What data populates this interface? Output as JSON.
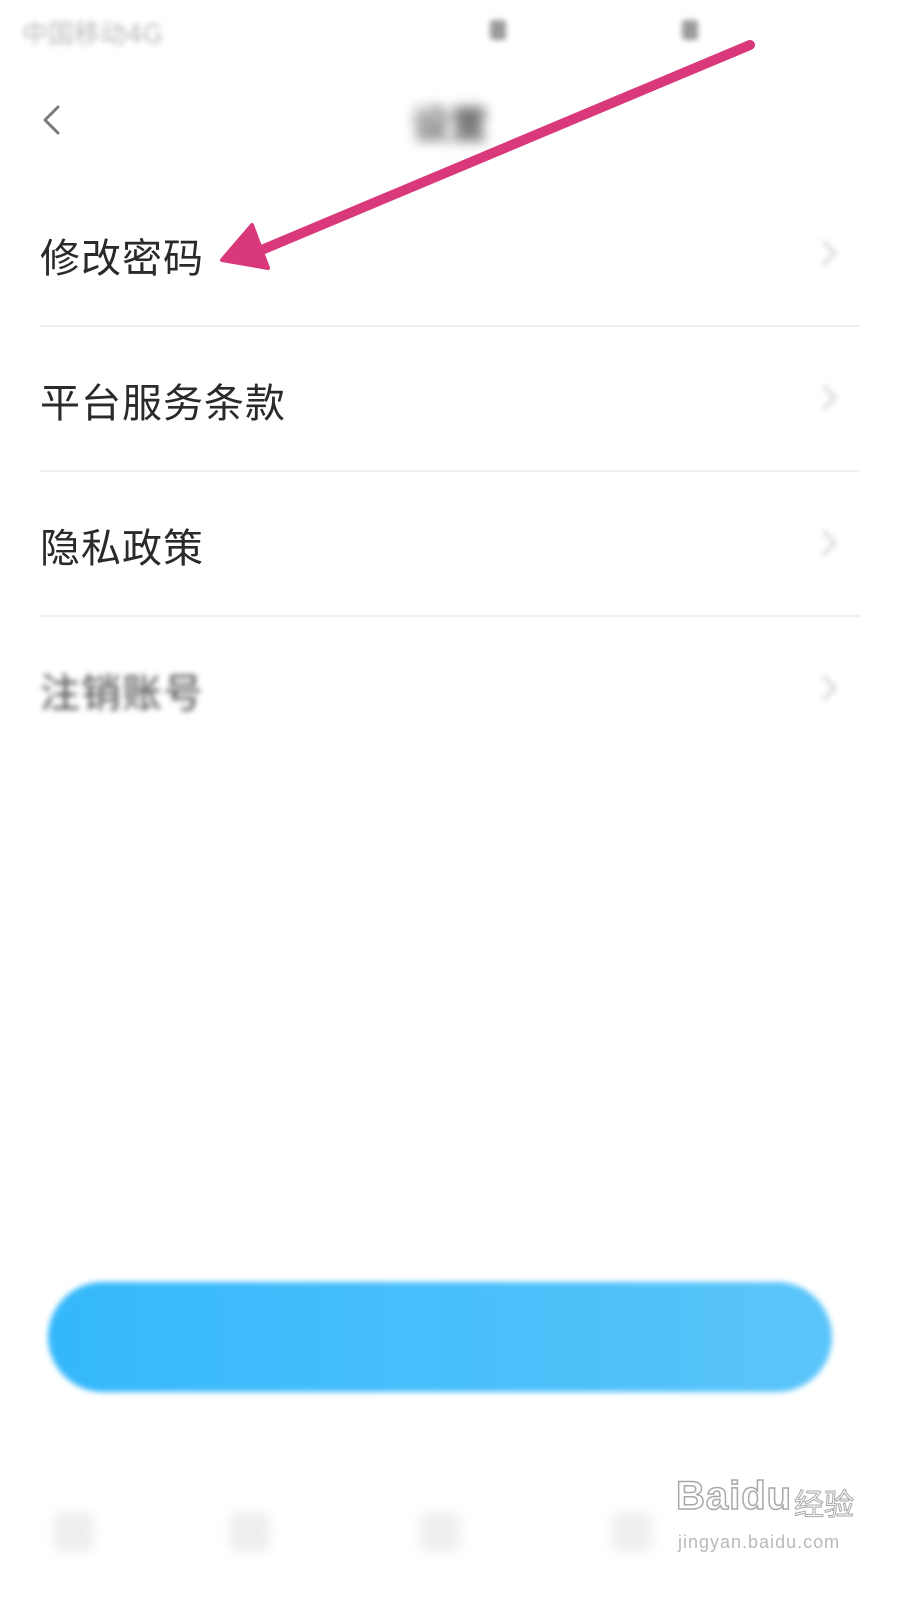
{
  "status_bar": {
    "carrier": "中国移动4G"
  },
  "nav_bar": {
    "title": "设置",
    "back_icon": "chevron-left-icon"
  },
  "settings": {
    "items": [
      {
        "label": "修改密码",
        "icon": "chevron-right-icon"
      },
      {
        "label": "平台服务条款",
        "icon": "chevron-right-icon"
      },
      {
        "label": "隐私政策",
        "icon": "chevron-right-icon"
      },
      {
        "label": "注销账号",
        "icon": "chevron-right-icon"
      }
    ]
  },
  "logout_button": {
    "color": "#3bbcfb"
  },
  "annotation": {
    "arrow_color": "#d9387a"
  },
  "watermark": {
    "brand": "Baidu",
    "product": "经验",
    "url": "jingyan.baidu.com"
  }
}
